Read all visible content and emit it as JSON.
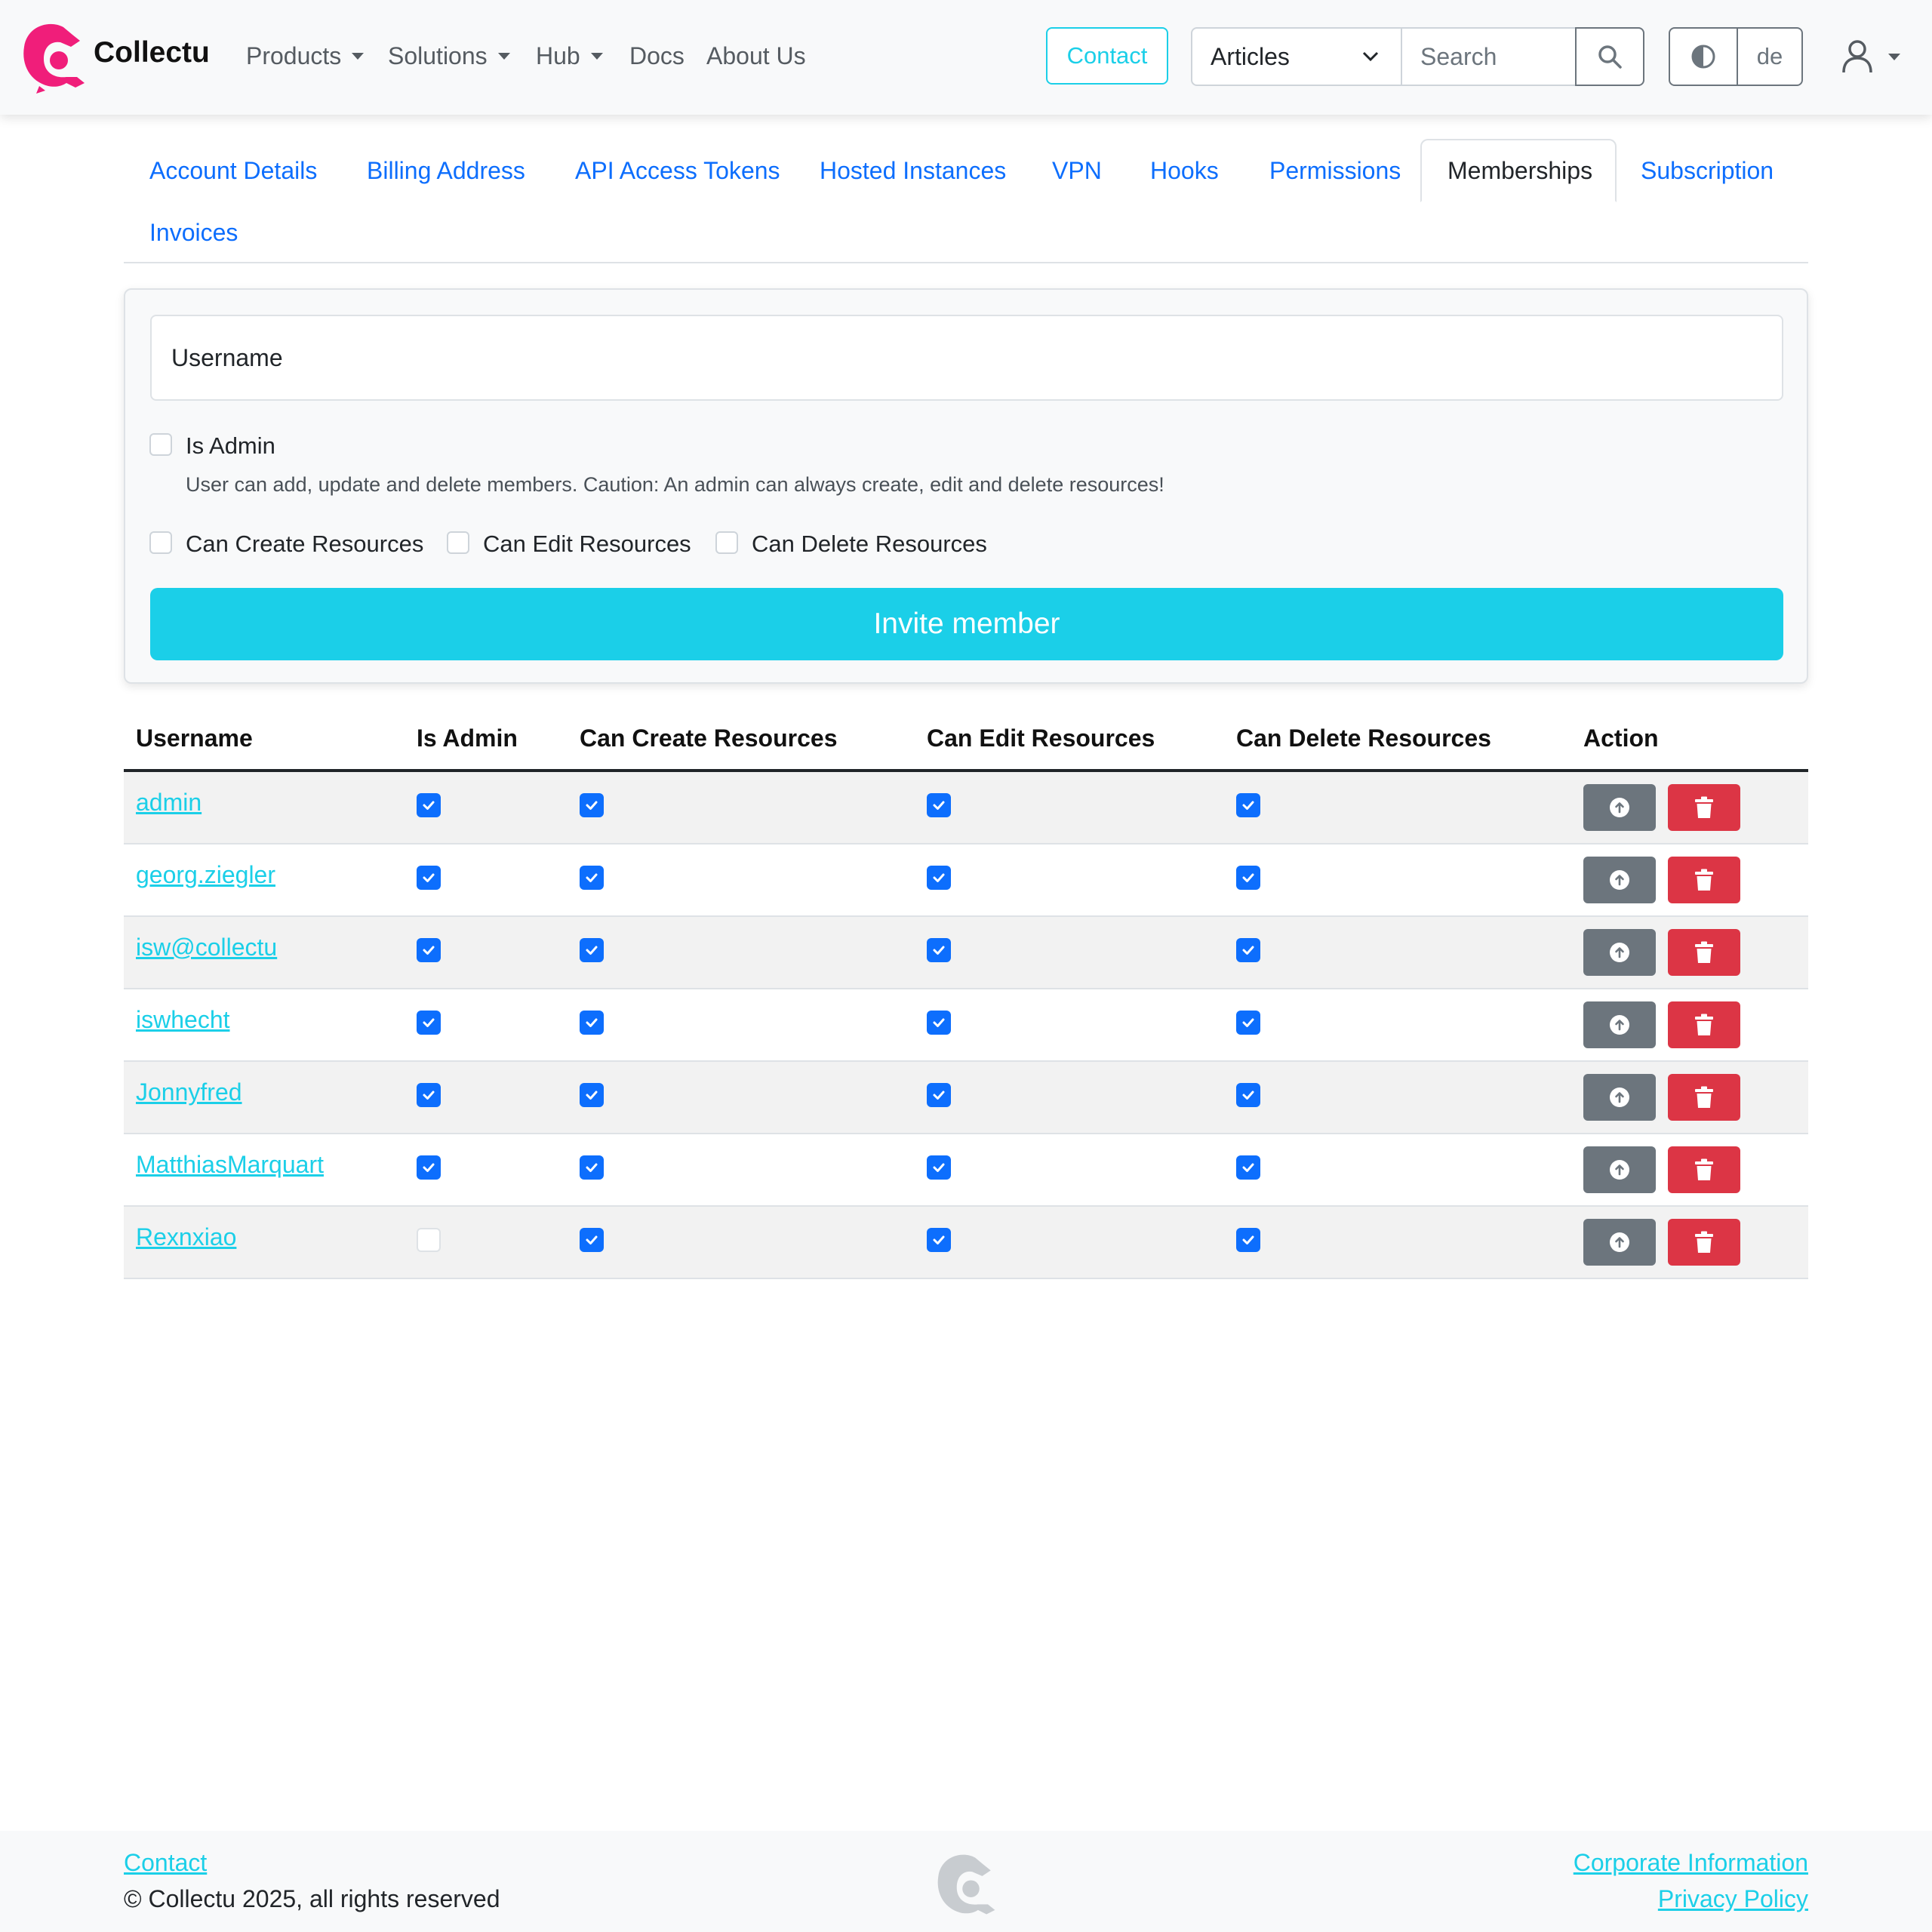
{
  "brand": {
    "name": "Collectu",
    "logo": "collectu-logo",
    "color": "#f01e7a"
  },
  "nav": {
    "items": [
      {
        "label": "Products",
        "dropdown": true
      },
      {
        "label": "Solutions",
        "dropdown": true
      },
      {
        "label": "Hub",
        "dropdown": true
      },
      {
        "label": "Docs",
        "dropdown": false
      },
      {
        "label": "About Us",
        "dropdown": false
      }
    ],
    "contact_label": "Contact",
    "search_select_value": "Articles",
    "search_placeholder": "Search",
    "search_icon": "search-icon",
    "theme_icon": "contrast-icon",
    "language": "de",
    "user_icon": "user-icon"
  },
  "tabs": [
    {
      "label": "Account Details",
      "active": false
    },
    {
      "label": "Billing Address",
      "active": false
    },
    {
      "label": "API Access Tokens",
      "active": false
    },
    {
      "label": "Hosted Instances",
      "active": false
    },
    {
      "label": "VPN",
      "active": false
    },
    {
      "label": "Hooks",
      "active": false
    },
    {
      "label": "Permissions",
      "active": false
    },
    {
      "label": "Memberships",
      "active": true
    },
    {
      "label": "Subscription",
      "active": false
    },
    {
      "label": "Invoices",
      "active": false
    }
  ],
  "invite_form": {
    "username_placeholder": "Username",
    "is_admin_label": "Is Admin",
    "is_admin_help": "User can add, update and delete members. Caution: An admin can always create, edit and delete resources!",
    "can_create_label": "Can Create Resources",
    "can_edit_label": "Can Edit Resources",
    "can_delete_label": "Can Delete Resources",
    "submit_label": "Invite member",
    "submit_color": "#1bcfe8"
  },
  "members_table": {
    "columns": [
      "Username",
      "Is Admin",
      "Can Create Resources",
      "Can Edit Resources",
      "Can Delete Resources",
      "Action"
    ],
    "rows": [
      {
        "username": "admin",
        "is_admin": true,
        "can_create": true,
        "can_edit": true,
        "can_delete": true
      },
      {
        "username": "georg.ziegler",
        "is_admin": true,
        "can_create": true,
        "can_edit": true,
        "can_delete": true
      },
      {
        "username": "isw@collectu",
        "is_admin": true,
        "can_create": true,
        "can_edit": true,
        "can_delete": true
      },
      {
        "username": "iswhecht",
        "is_admin": true,
        "can_create": true,
        "can_edit": true,
        "can_delete": true
      },
      {
        "username": "Jonnyfred",
        "is_admin": true,
        "can_create": true,
        "can_edit": true,
        "can_delete": true
      },
      {
        "username": "MatthiasMarquart",
        "is_admin": true,
        "can_create": true,
        "can_edit": true,
        "can_delete": true
      },
      {
        "username": "Rexnxiao",
        "is_admin": false,
        "can_create": true,
        "can_edit": true,
        "can_delete": true
      }
    ],
    "actions": {
      "promote_icon": "arrow-up-circle-icon",
      "delete_icon": "trash-icon",
      "promote_color": "#6c757d",
      "delete_color": "#dc3545"
    }
  },
  "footer": {
    "contact_label": "Contact",
    "copyright": "© Collectu 2025, all rights reserved",
    "corporate_label": "Corporate Information",
    "privacy_label": "Privacy Policy",
    "logo": "collectu-logo-grey"
  }
}
